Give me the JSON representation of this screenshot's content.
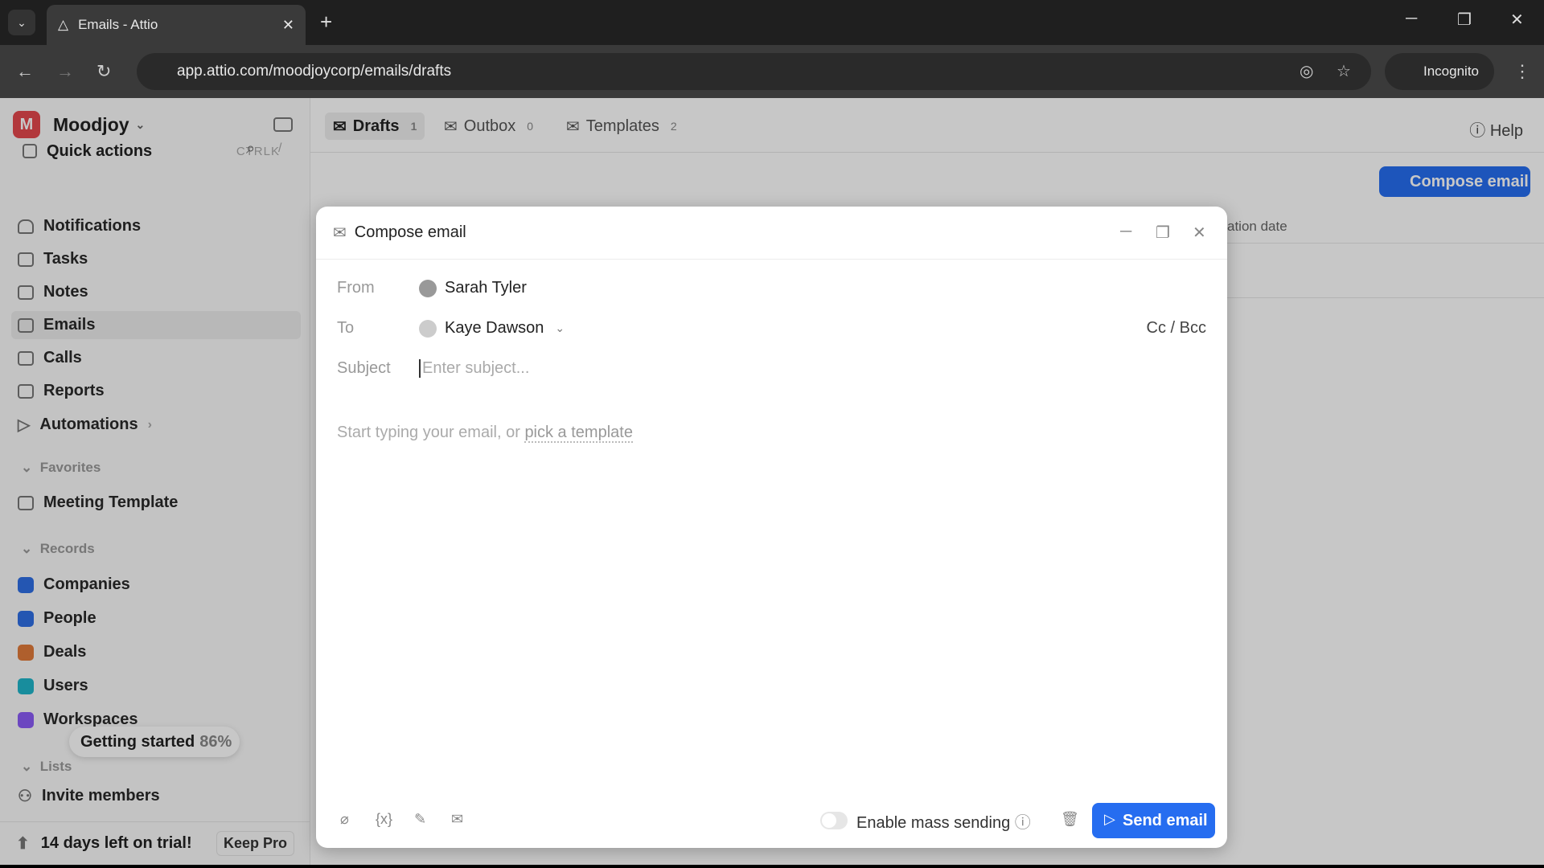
{
  "browser": {
    "tab_title": "Emails - Attio",
    "url": "app.attio.com/moodjoycorp/emails/drafts",
    "incognito": "Incognito"
  },
  "workspace": {
    "initial": "M",
    "name": "Moodjoy"
  },
  "quick_actions": {
    "label": "Quick actions",
    "shortcut": "CTRLK",
    "slash": "/"
  },
  "nav": [
    {
      "label": "Notifications"
    },
    {
      "label": "Tasks"
    },
    {
      "label": "Notes"
    },
    {
      "label": "Emails"
    },
    {
      "label": "Calls"
    },
    {
      "label": "Reports"
    },
    {
      "label": "Automations"
    }
  ],
  "favorites": {
    "title": "Favorites",
    "items": [
      {
        "label": "Meeting Template"
      }
    ]
  },
  "records": {
    "title": "Records",
    "items": [
      {
        "label": "Companies",
        "color": "#2f6fe4"
      },
      {
        "label": "People",
        "color": "#2f6fe4"
      },
      {
        "label": "Deals",
        "color": "#e07a3a"
      },
      {
        "label": "Users",
        "color": "#1fb5c9"
      },
      {
        "label": "Workspaces",
        "color": "#8b5cf6"
      }
    ]
  },
  "getting_started": {
    "label": "Getting started",
    "percent": "86%"
  },
  "lists_title": "Lists",
  "invite": "Invite members",
  "trial": {
    "text": "14 days left on trial!",
    "button": "Keep Pro"
  },
  "tabs": [
    {
      "label": "Drafts",
      "count": "1"
    },
    {
      "label": "Outbox",
      "count": "0"
    },
    {
      "label": "Templates",
      "count": "2"
    }
  ],
  "help": "Help",
  "compose_button": "Compose email",
  "column_header": "ation date",
  "modal": {
    "title": "Compose email",
    "from_label": "From",
    "from": "Sarah Tyler",
    "to_label": "To",
    "to": "Kaye Dawson",
    "ccbcc": "Cc / Bcc",
    "subject_label": "Subject",
    "subject_placeholder": "Enter subject...",
    "body_placeholder": "Start typing your email, or ",
    "template_link": "pick a template",
    "mass_sending": "Enable mass sending",
    "send": "Send email"
  }
}
